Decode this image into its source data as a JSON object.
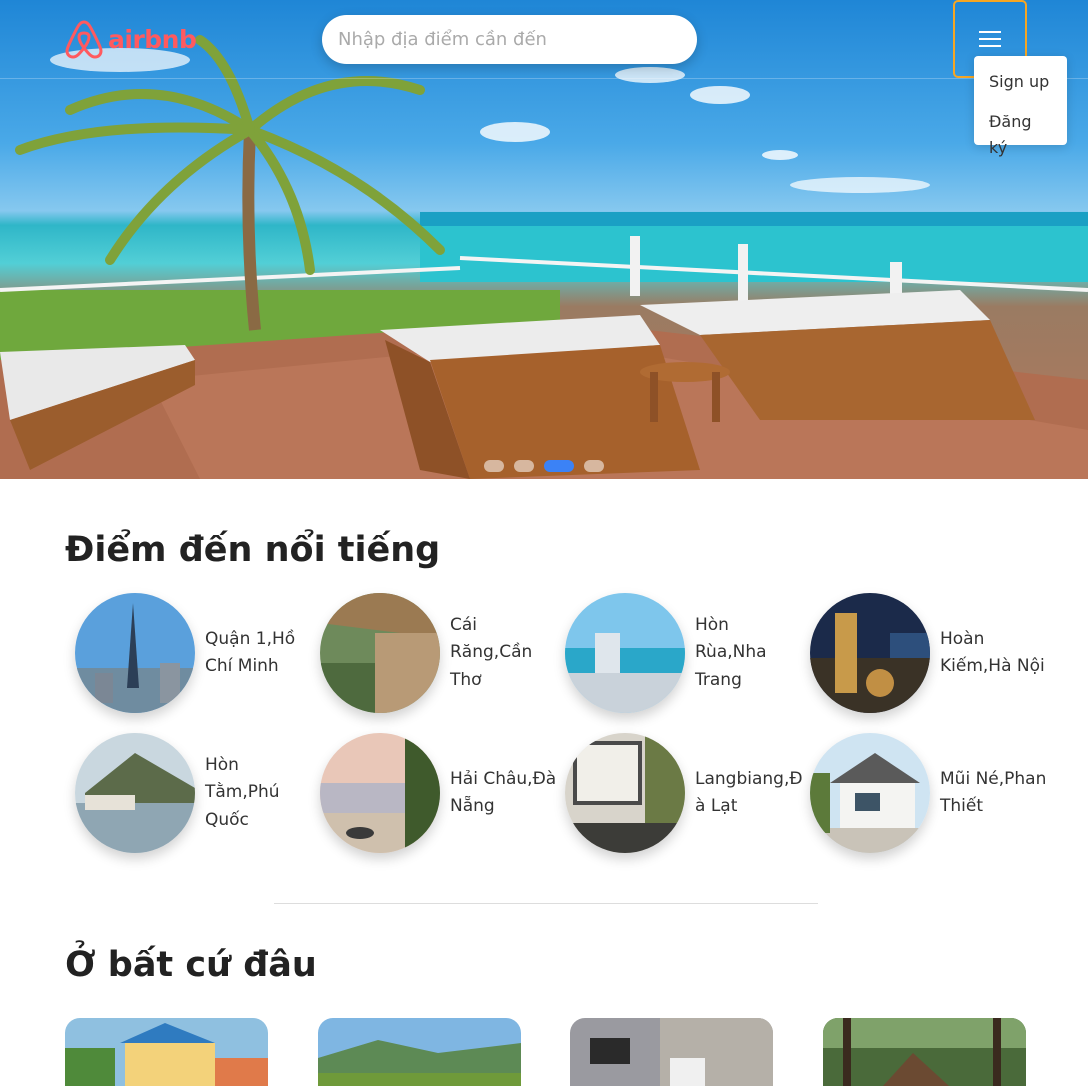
{
  "header": {
    "logo_text": "airbnb",
    "search_placeholder": "Nhập địa điểm cần đến",
    "menu_items": [
      "Sign up",
      "Đăng ký"
    ]
  },
  "carousel": {
    "total": 4,
    "active_index": 2
  },
  "popular": {
    "title": "Điểm đến nổi tiếng",
    "items": [
      "Quận 1,Hồ Chí Minh",
      "Cái Răng,Cần Thơ",
      "Hòn Rùa,Nha Trang",
      "Hoàn Kiếm,Hà Nội",
      "Hòn Tằm,Phú Quốc",
      "Hải Châu,Đà Nẵng",
      "Langbiang,Đà Lạt",
      "Mũi Né,Phan Thiết"
    ]
  },
  "anywhere": {
    "title": "Ở bất cứ đâu"
  },
  "colors": {
    "brand": "#ff5a5f",
    "menu_border": "#f5a623",
    "active_dot": "#3b82f6"
  }
}
